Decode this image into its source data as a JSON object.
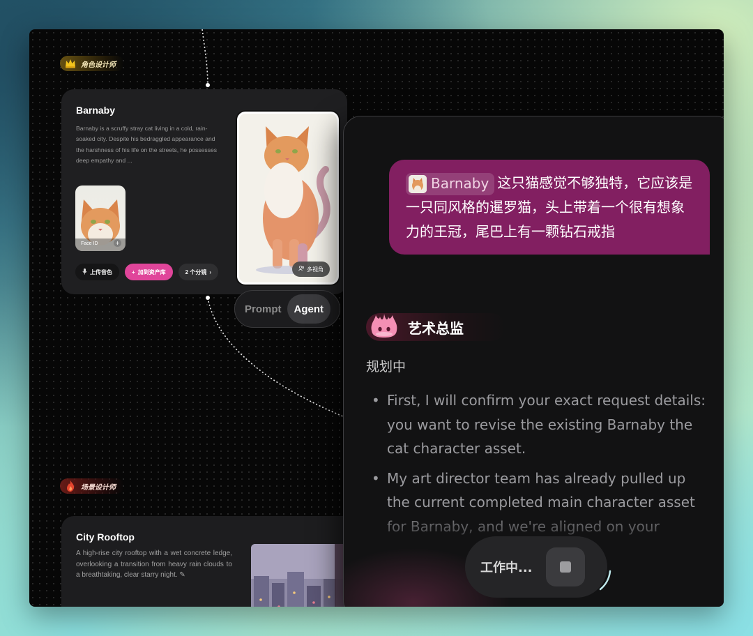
{
  "canvas": {
    "character_role_tag": "角色设计师",
    "scene_role_tag": "场景设计师"
  },
  "character_card": {
    "name": "Barnaby",
    "description": "Barnaby is a scruffy stray cat living in a cold, rain-soaked city. Despite his bedraggled appearance and the harshness of his life on the streets, he possesses deep empathy and ...",
    "face_id_label": "Face ID",
    "buttons": {
      "upload_voice": "上传音色",
      "add_to_assets": "加到资产库",
      "shots": "2 个分镜"
    },
    "multi_view_label": "多视角"
  },
  "mode_toggle": {
    "options": [
      "Prompt",
      "Agent"
    ],
    "active": "Agent"
  },
  "scene_card": {
    "name": "City Rooftop",
    "description": "A high-rise city rooftop with a wet concrete ledge, overlooking a transition from heavy rain clouds to a breathtaking, clear starry night."
  },
  "chat": {
    "user_message": {
      "mention": "Barnaby",
      "text": "这只猫感觉不够独特，它应该是一只同风格的暹罗猫，头上带着一个很有想象力的王冠，尾巴上有一颗钻石戒指"
    },
    "agent": {
      "name": "艺术总监",
      "status": "规划中",
      "bullets": [
        "First, I will confirm your exact request details: you want to revise the existing Barnaby the cat character asset.",
        "My art director team has already pulled up the current completed main character asset for Barnaby, and we're aligned on your"
      ]
    },
    "working": {
      "label": "工作中..."
    }
  },
  "colors": {
    "accent_pink": "#e0459a",
    "user_bubble": "#821f61",
    "canvas_bg": "#070707"
  }
}
